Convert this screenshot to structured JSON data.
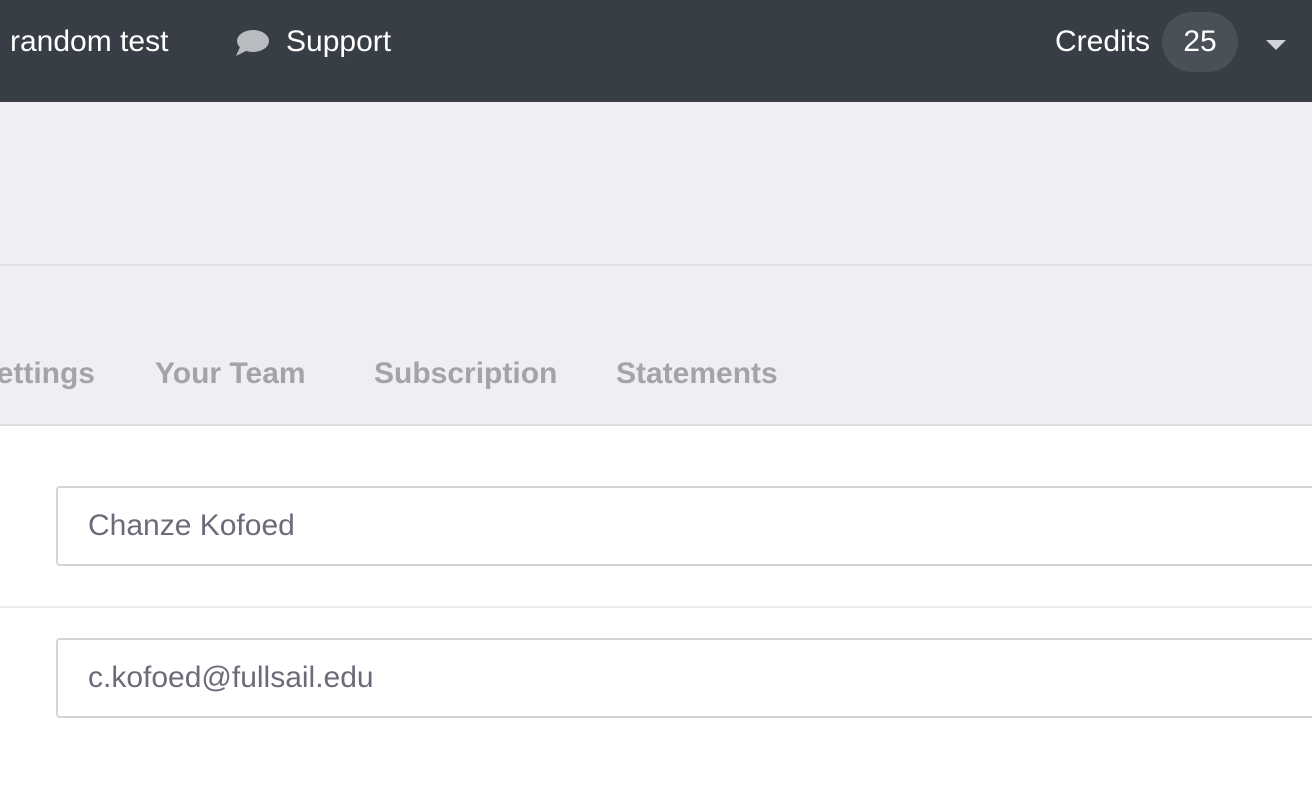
{
  "topbar": {
    "project_name": "random test",
    "support_label": "Support",
    "credits_label": "Credits",
    "credits_value": "25",
    "icons": {
      "support": "chat-bubble-icon",
      "menu": "caret-down-icon"
    }
  },
  "tabs": [
    {
      "label": "ettings"
    },
    {
      "label": "Your Team"
    },
    {
      "label": "Subscription"
    },
    {
      "label": "Statements"
    }
  ],
  "form": {
    "name_value": "Chanze Kofoed",
    "email_value": "c.kofoed@fullsail.edu"
  },
  "colors": {
    "topbar_bg": "#383e45",
    "header_bg": "#efeef3",
    "tab_text": "#a3a3a8",
    "field_text": "#6b6b7a"
  }
}
